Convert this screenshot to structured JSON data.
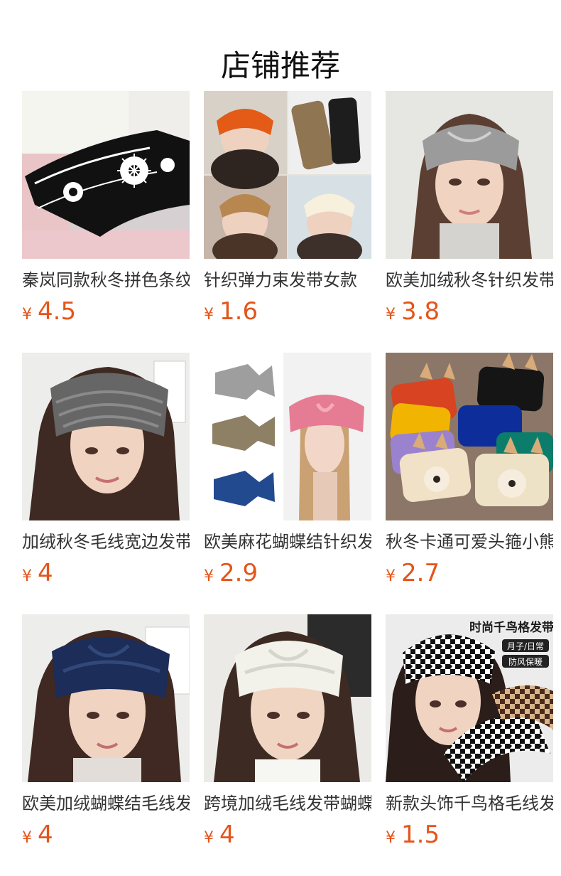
{
  "page": {
    "title": "店铺推荐"
  },
  "colors": {
    "price": "#e4551b",
    "title": "#111111",
    "text": "#333333"
  },
  "products": [
    {
      "name": "秦岚同款秋冬拼色条纹",
      "currency": "¥",
      "price": "4.5",
      "image_icon": "black-snowflake-knit-headband-image"
    },
    {
      "name": "针织弹力束发带女款",
      "currency": "¥",
      "price": "1.6",
      "image_icon": "knit-headband-collage-image"
    },
    {
      "name": "欧美加绒秋冬针织发带",
      "currency": "¥",
      "price": "3.8",
      "image_icon": "gray-knit-headband-model-image"
    },
    {
      "name": "加绒秋冬毛线宽边发带",
      "currency": "¥",
      "price": "4",
      "image_icon": "dark-gray-knit-headband-model-image"
    },
    {
      "name": "欧美麻花蝴蝶结针织发带",
      "currency": "¥",
      "price": "2.9",
      "image_icon": "bow-knit-headband-assortment-image"
    },
    {
      "name": "秋冬卡通可爱头箍小熊",
      "currency": "¥",
      "price": "2.7",
      "image_icon": "cartoon-bear-headbands-image"
    },
    {
      "name": "欧美加绒蝴蝶结毛线发带",
      "currency": "¥",
      "price": "4",
      "image_icon": "navy-knit-headband-model-image"
    },
    {
      "name": "跨境加绒毛线发带蝴蝶结",
      "currency": "¥",
      "price": "4",
      "image_icon": "white-knit-headband-model-image"
    },
    {
      "name": "新款头饰千鸟格毛线发带",
      "currency": "¥",
      "price": "1.5",
      "image_icon": "houndstooth-headband-promo-image",
      "promo": {
        "headline": "时尚千鸟格发带",
        "badge_1": "月子/日常",
        "badge_2": "防风保暖"
      }
    }
  ]
}
